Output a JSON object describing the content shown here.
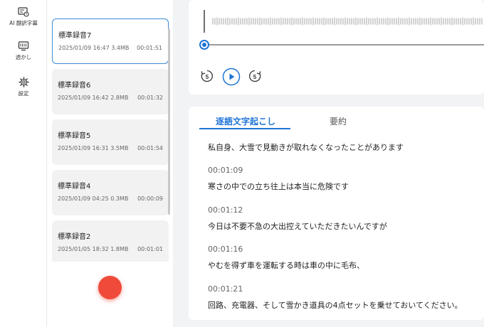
{
  "nav": {
    "items": [
      {
        "label": "AI 翻訳字幕",
        "icon": "subtitle-translate-icon"
      },
      {
        "label": "透かし",
        "icon": "watermark-icon"
      },
      {
        "label": "設定",
        "icon": "gear-icon"
      }
    ]
  },
  "recordings": [
    {
      "title": "標準録音7",
      "meta": "2025/01/09 16:47 3.4MB",
      "duration": "00:01:51",
      "active": true
    },
    {
      "title": "標準録音6",
      "meta": "2025/01/09 16:42 2.8MB",
      "duration": "00:01:32"
    },
    {
      "title": "標準録音5",
      "meta": "2025/01/09 16:31 3.5MB",
      "duration": "00:01:54"
    },
    {
      "title": "標準録音4",
      "meta": "2025/01/09 04:25 0.3MB",
      "duration": "00:00:09"
    },
    {
      "title": "標準録音2",
      "meta": "2025/01/05 18:32 1.8MB",
      "duration": "00:01:01"
    }
  ],
  "player": {
    "progress": 0.0,
    "controls": [
      "rewind-5-icon",
      "play-icon",
      "forward-5-icon"
    ],
    "rewind_label": "5",
    "forward_label": "5"
  },
  "transcript": {
    "tabs": [
      {
        "label": "逐語文字起こし",
        "active": true
      },
      {
        "label": "要約",
        "active": false
      }
    ],
    "segments": [
      {
        "time": "",
        "text": "私自身、大雪で見動きが取れなくなったことがあります"
      },
      {
        "time": "00:01:09",
        "text": "寒さの中での立ち往上は本当に危険です"
      },
      {
        "time": "00:01:12",
        "text": "今日は不要不急の大出控えていただきたいんですが"
      },
      {
        "time": "00:01:16",
        "text": "やむを得ず車を運転する時は車の中に毛布、"
      },
      {
        "time": "00:01:21",
        "text": "回路、充電器、そして雪かき道具の4点セットを乗せておいてください。"
      }
    ]
  },
  "colors": {
    "accent": "#1f74d6",
    "record": "#f04a3a",
    "card": "#f2f2f3",
    "background": "#f2f3f5"
  }
}
